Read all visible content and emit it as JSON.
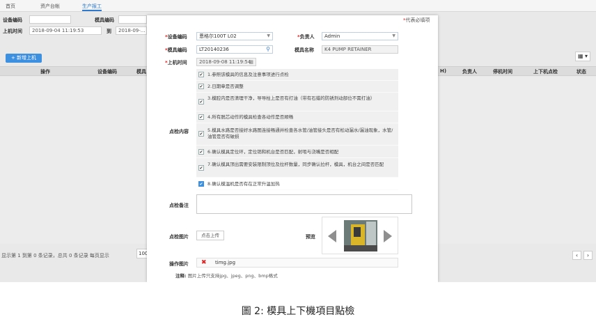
{
  "tabs": [
    {
      "label": "首页"
    },
    {
      "label": "资产台帐"
    },
    {
      "label": "生产报工"
    }
  ],
  "background": {
    "filters": {
      "device_code_label": "设备编码",
      "mold_code_label": "模具编码",
      "online_time_label": "上机时间",
      "online_time_from": "2018-09-04 11:19:53",
      "to_label": "到",
      "online_time_to": "2018-09-..."
    },
    "add_button": "+ 新增上机",
    "columns_button": "▦ ▾",
    "table_headers": [
      "操作",
      "设备编码",
      "模具",
      "H)",
      "负责人",
      "停机时间",
      "上下机点检",
      "状态"
    ],
    "footer_text": "显示第 1 到第 0 条记录，总共 0 条记录 每页显示",
    "page_size": "100",
    "pager_prev": "‹",
    "pager_next": "›"
  },
  "modal": {
    "required_note_star": "*",
    "required_note_text": "代表必填项",
    "device_code": {
      "label": "设备编码",
      "value": "恩格尔100T L02"
    },
    "owner": {
      "label": "负责人",
      "value": "Admin"
    },
    "mold_code": {
      "label": "模具编码",
      "value": "LT20140236"
    },
    "mold_name": {
      "label": "模具名称",
      "value": "K4 PUMP RETAINER"
    },
    "online_time": {
      "label": "上机时间",
      "value": "2018-09-08 11:19:54"
    },
    "check_content_label": "点检内容",
    "check_items": [
      {
        "text": "1.参照该模具的信息及注意事项进行点检",
        "checked": true,
        "highlight": false
      },
      {
        "text": "2.日期章是否调整",
        "checked": true,
        "highlight": false
      },
      {
        "text": "3.模腔内是否清理干净，导导柱上是否有打油（带有石蜡的防锈剂动部位不需打油）",
        "checked": true,
        "highlight": false
      },
      {
        "text": "4.所有脱芯动作的模具检查各动作是否顺畅",
        "checked": true,
        "highlight": false
      },
      {
        "text": "5.模具水路是否接好水路图连接畅通并检查各水管/油管接头是否有松动漏水/漏油现象，水管/油管是否有破损",
        "checked": true,
        "highlight": false
      },
      {
        "text": "6.确认模具定位环，定位销和机台是否匹配，射咀与浇嘴是否相配",
        "checked": true,
        "highlight": false
      },
      {
        "text": "7.确认模具顶出需要安装限制顶位及拉杆数量，同步确认拉杆，模具，机台之间是否匹配",
        "checked": true,
        "highlight": false
      },
      {
        "text": "8.确认模温机是否有在正常升温加热",
        "checked": true,
        "highlight": true
      }
    ],
    "remark_label": "点检备注",
    "photo_label": "点检图片",
    "upload_button": "点击上传",
    "preview_label": "预览",
    "op_photo_label": "操作图片",
    "file_name": "timg.jpg",
    "note_label": "注释:",
    "note_text": "图片上传只支持jpg、jpeg、png、bmp格式"
  },
  "caption": "圖 2: 模具上下機項目點檢",
  "colors": {
    "accent": "#3d8fe0",
    "required": "#e02020"
  }
}
